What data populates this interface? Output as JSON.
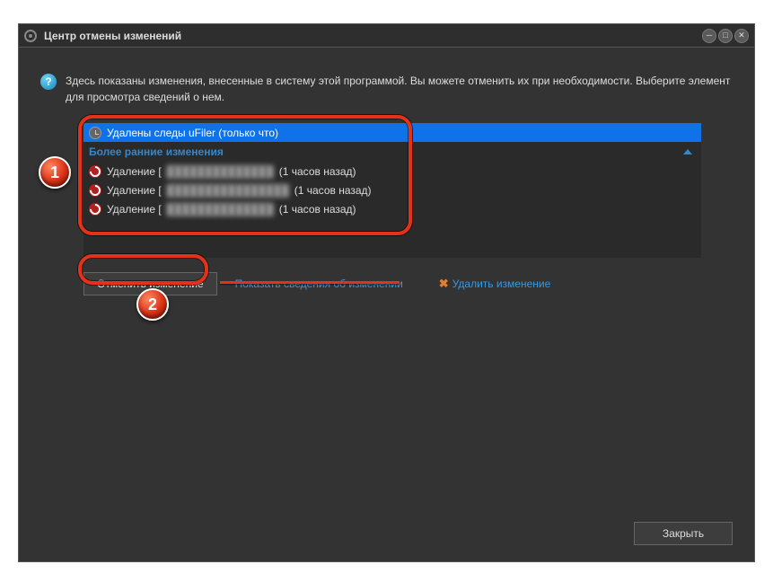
{
  "window": {
    "title": "Центр отмены изменений"
  },
  "info": {
    "text": "Здесь показаны изменения, внесенные в систему этой программой. Вы можете отменить их при необходимости. Выберите элемент для просмотра сведений о нем."
  },
  "list": {
    "selected": {
      "label": "Удалены следы uFiler (только что)"
    },
    "earlier_header": "Более ранние изменения",
    "items": [
      {
        "prefix": "Удаление [",
        "redacted": "██████████████",
        "suffix": "(1 часов назад)"
      },
      {
        "prefix": "Удаление [",
        "redacted": "████████████████",
        "suffix": "(1 часов назад)"
      },
      {
        "prefix": "Удаление [",
        "redacted": "██████████████",
        "suffix": "(1 часов назад)"
      }
    ]
  },
  "actions": {
    "undo": "Отменить изменение",
    "details": "Показать сведения об изменении",
    "delete": "Удалить изменение"
  },
  "footer": {
    "close": "Закрыть"
  },
  "annotations": {
    "badge1": "1",
    "badge2": "2"
  }
}
